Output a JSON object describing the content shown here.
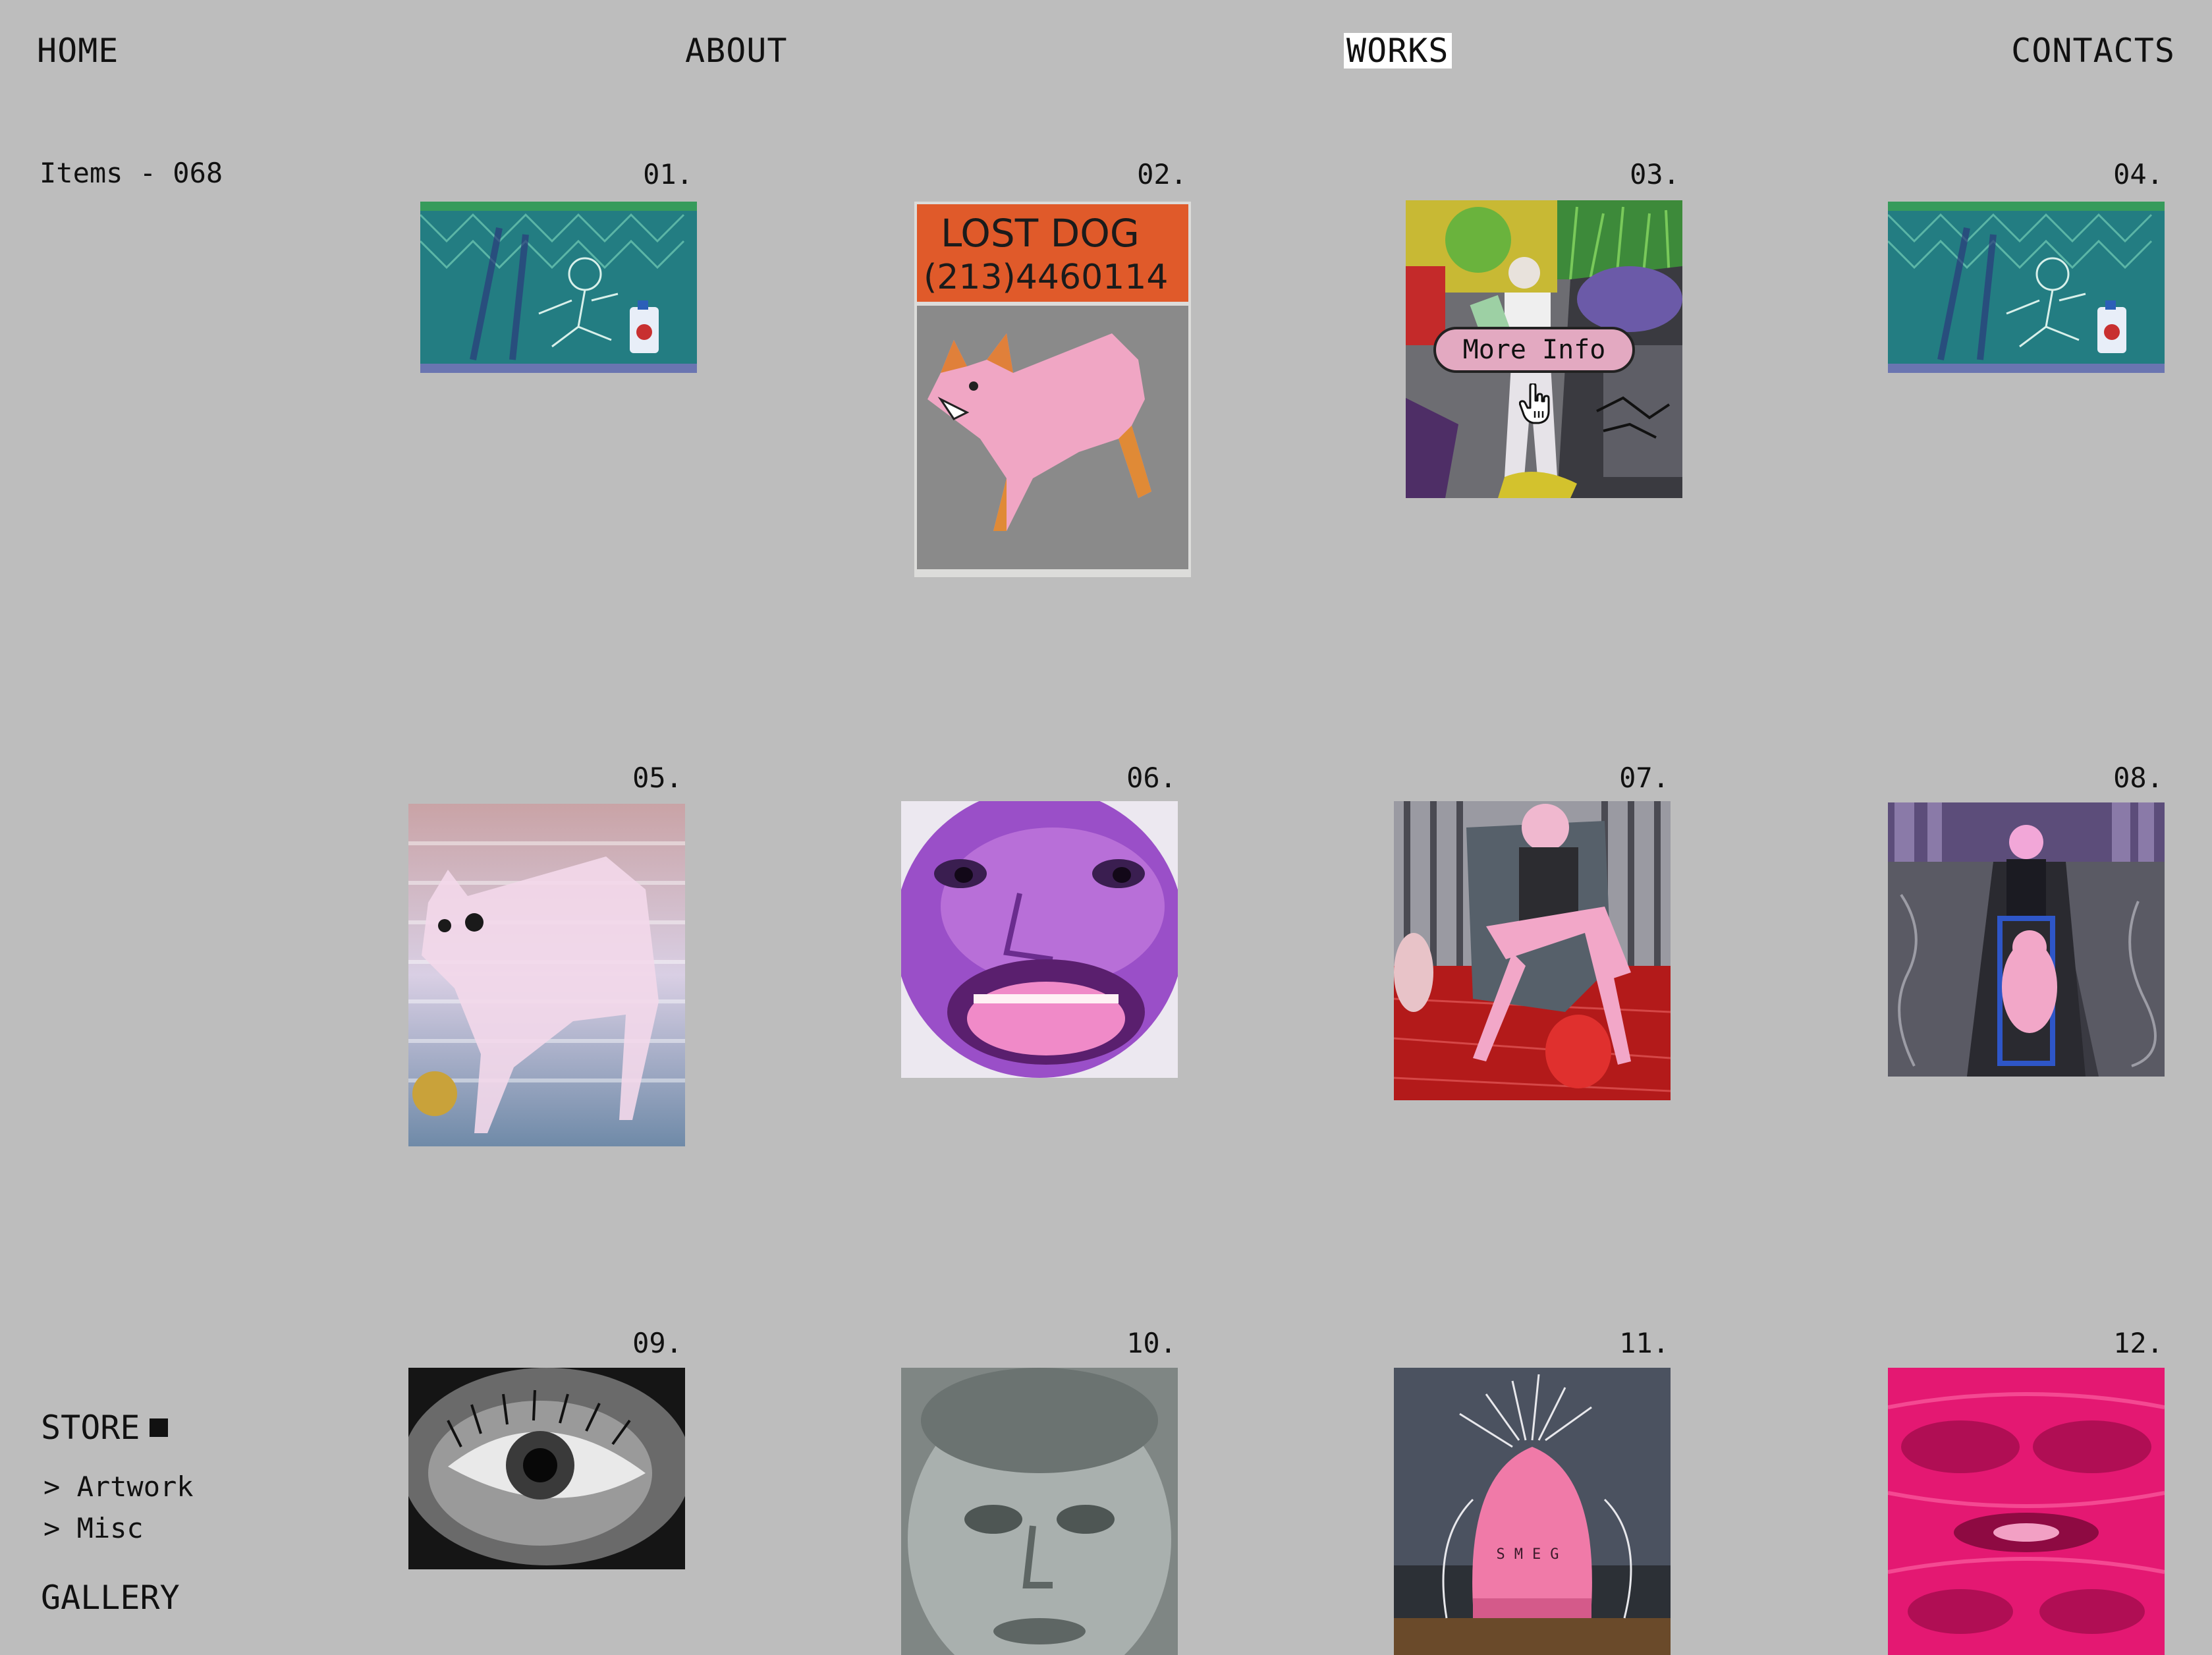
{
  "nav": {
    "home": "HOME",
    "about": "ABOUT",
    "works": "WORKS",
    "contacts": "CONTACTS",
    "active": "WORKS"
  },
  "sidebar": {
    "items_count": "Items - 068",
    "store": {
      "label": "STORE",
      "links": [
        "> Artwork",
        "> Misc"
      ]
    },
    "gallery": "GALLERY"
  },
  "works": [
    {
      "number": "01.",
      "image": "teal chain-link fence figure with bottle"
    },
    {
      "number": "02.",
      "image": "lost dog poster with pink dog"
    },
    {
      "number": "03.",
      "image": "figure in garden with grill"
    },
    {
      "number": "04.",
      "image": "teal chain-link fence figure with bottle"
    },
    {
      "number": "05.",
      "image": "pink dog with light streaks"
    },
    {
      "number": "06.",
      "image": "purple screaming face"
    },
    {
      "number": "07.",
      "image": "seated woman in chair red floor"
    },
    {
      "number": "08.",
      "image": "figure pushing stroller"
    },
    {
      "number": "09.",
      "image": "black and white eye closeup"
    },
    {
      "number": "10.",
      "image": "grey blurred face"
    },
    {
      "number": "11.",
      "image": "pink kettle with wires"
    },
    {
      "number": "12.",
      "image": "magenta distorted faces"
    }
  ],
  "lost_dog_poster": {
    "line1": "LOST DOG",
    "line2": "(213)4460114"
  },
  "kettle_letters": "SMEG",
  "overlay": {
    "more_info": "More Info",
    "cursor_icon": "hand-pointer-icon"
  },
  "colors": {
    "background": "#bdbdbd",
    "text": "#111111",
    "active_nav_bg": "#ffffff",
    "pill": "#e3a9c1"
  }
}
